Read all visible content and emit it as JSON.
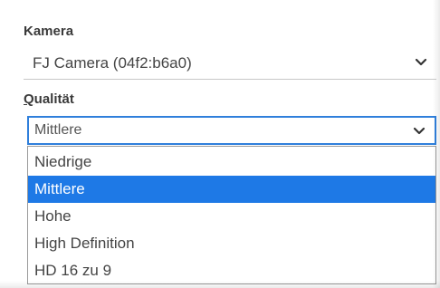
{
  "camera": {
    "label": "Kamera",
    "value": "FJ Camera (04f2:b6a0)",
    "chevron_icon": "chevron-down-icon"
  },
  "quality": {
    "label_first": "Q",
    "label_rest": "ualität",
    "value": "Mittlere",
    "chevron_icon": "chevron-down-icon",
    "options": [
      {
        "label": "Niedrige",
        "selected": false
      },
      {
        "label": "Mittlere",
        "selected": true
      },
      {
        "label": "Hohe",
        "selected": false
      },
      {
        "label": "High Definition",
        "selected": false
      },
      {
        "label": "HD 16 zu 9",
        "selected": false
      }
    ]
  },
  "colors": {
    "focus_border": "#2f7fdb",
    "selected_bg": "#1e79e6"
  }
}
